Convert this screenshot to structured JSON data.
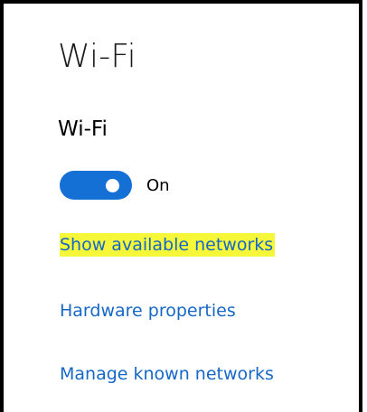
{
  "page": {
    "title": "Wi-Fi"
  },
  "wifi": {
    "section_title": "Wi-Fi",
    "toggle_state_label": "On",
    "enabled": true
  },
  "links": {
    "show_available_networks": "Show available networks",
    "hardware_properties": "Hardware properties",
    "manage_known_networks": "Manage known networks"
  },
  "colors": {
    "accent": "#1570d6",
    "link": "#1667c6",
    "highlight": "#f7f73a"
  }
}
